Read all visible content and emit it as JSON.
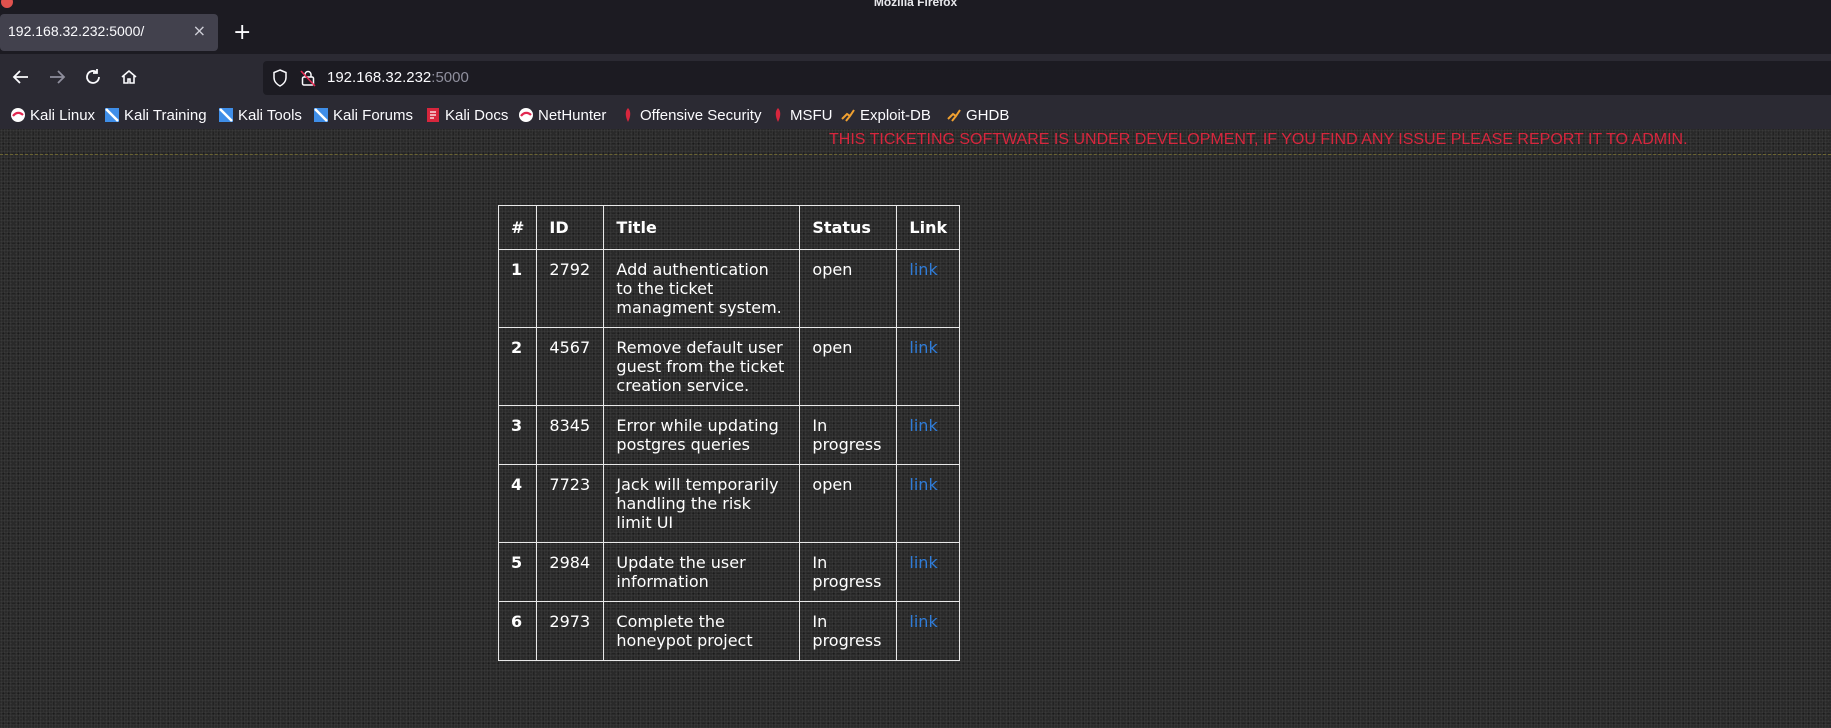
{
  "window": {
    "title": "Mozilla Firefox"
  },
  "tab": {
    "title": "192.168.32.232:5000/",
    "close": "×"
  },
  "newtab": "+",
  "url": {
    "host": "192.168.32.232",
    "port": ":5000"
  },
  "bookmarks": [
    {
      "label": "Kali Linux",
      "icon": "kali-dragon-icon"
    },
    {
      "label": "Kali Training",
      "icon": "kali-training-icon"
    },
    {
      "label": "Kali Tools",
      "icon": "kali-tools-icon"
    },
    {
      "label": "Kali Forums",
      "icon": "kali-forums-icon"
    },
    {
      "label": "Kali Docs",
      "icon": "kali-docs-icon"
    },
    {
      "label": "NetHunter",
      "icon": "nethunter-icon"
    },
    {
      "label": "Offensive Security",
      "icon": "offsec-icon"
    },
    {
      "label": "MSFU",
      "icon": "msfu-icon"
    },
    {
      "label": "Exploit-DB",
      "icon": "exploitdb-icon"
    },
    {
      "label": "GHDB",
      "icon": "ghdb-icon"
    }
  ],
  "banner": "THIS TICKETING SOFTWARE IS UNDER DEVELOPMENT, IF YOU FIND ANY ISSUE PLEASE REPORT IT TO ADMIN.",
  "table": {
    "headers": [
      "#",
      "ID",
      "Title",
      "Status",
      "Link"
    ],
    "rows": [
      {
        "num": "1",
        "id": "2792",
        "title": "Add authentication to the ticket managment system.",
        "status": "open",
        "link": "link"
      },
      {
        "num": "2",
        "id": "4567",
        "title": "Remove default user guest from the ticket creation service.",
        "status": "open",
        "link": "link"
      },
      {
        "num": "3",
        "id": "8345",
        "title": "Error while updating postgres queries",
        "status": "In progress",
        "link": "link"
      },
      {
        "num": "4",
        "id": "7723",
        "title": "Jack will temporarily handling the risk limit UI",
        "status": "open",
        "link": "link"
      },
      {
        "num": "5",
        "id": "2984",
        "title": "Update the user information",
        "status": "In progress",
        "link": "link"
      },
      {
        "num": "6",
        "id": "2973",
        "title": "Complete the honeypot project",
        "status": "In progress",
        "link": "link"
      }
    ]
  },
  "colors": {
    "banner": "#d7263d",
    "link": "#2f7cd8"
  }
}
